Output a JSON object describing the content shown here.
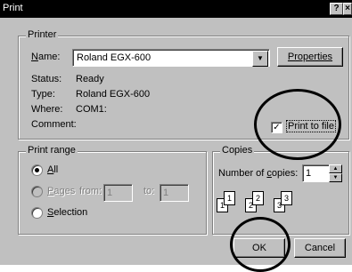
{
  "window": {
    "title": "Print",
    "help_btn": "?",
    "close_btn": "×"
  },
  "printer": {
    "legend": "Printer",
    "name_label": "Name:",
    "name_value": "Roland EGX-600",
    "properties_btn": "Properties",
    "status_label": "Status:",
    "status_value": "Ready",
    "type_label": "Type:",
    "type_value": "Roland EGX-600",
    "where_label": "Where:",
    "where_value": "COM1:",
    "comment_label": "Comment:",
    "print_to_file_label": "Print to file",
    "print_to_file_checked": true
  },
  "print_range": {
    "legend": "Print range",
    "all_label": "All",
    "pages_label": "Pages",
    "from_label": "from:",
    "from_value": "1",
    "to_label": "to:",
    "to_value": "1",
    "selection_label": "Selection",
    "selected": "all"
  },
  "copies": {
    "legend": "Copies",
    "num_label": "Number of copies:",
    "num_value": "1",
    "collate_pages": [
      "1",
      "1",
      "2",
      "2",
      "3",
      "3"
    ]
  },
  "buttons": {
    "ok": "OK",
    "cancel": "Cancel"
  },
  "icons": {
    "check": "check-icon",
    "dropdown": "chevron-down-icon",
    "spin_up": "arrow-up-icon",
    "spin_down": "arrow-down-icon"
  }
}
